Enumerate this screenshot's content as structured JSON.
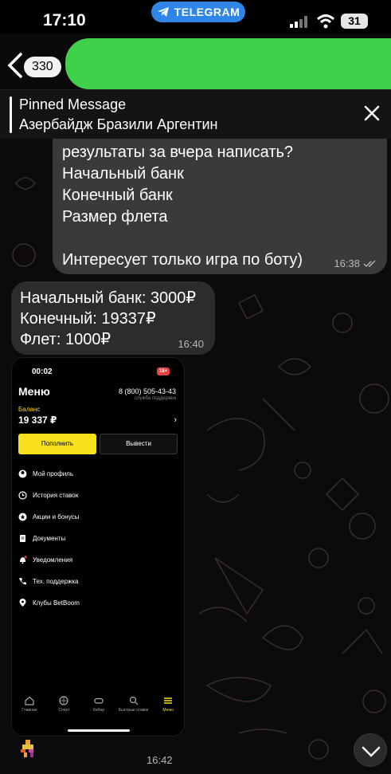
{
  "status_bar": {
    "time": "17:10",
    "app_pill": "TELEGRAM",
    "battery": "31"
  },
  "header": {
    "unread_count": "330"
  },
  "pinned": {
    "title": "Pinned Message",
    "text": "Азербайдж Бразили Аргентин"
  },
  "messages": {
    "outgoing": {
      "lines": [
        "результаты за вчера написать?",
        "Начальный банк",
        "Конечный банк",
        "Размер флета",
        "",
        "Интересует только игра по боту)"
      ],
      "time": "16:38"
    },
    "incoming": {
      "lines": [
        "Начальный банк: 3000₽",
        "Конечный: 19337₽",
        "Флет: 1000₽"
      ],
      "time": "16:40"
    },
    "last_time": "16:42"
  },
  "embedded": {
    "time": "00:02",
    "age": "18+",
    "title": "Меню",
    "phone": "8 (800) 505-43-43",
    "phone_sub": "служба поддержки",
    "balance_label": "Баланс",
    "balance": "19 337 ₽",
    "deposit": "Пополнить",
    "withdraw": "Вывести",
    "menu_items": [
      "Мой профиль",
      "История ставок",
      "Акции и бонусы",
      "Документы",
      "Уведомления",
      "Тех. поддержка",
      "Клубы BetBoom"
    ],
    "tabs": [
      "Главная",
      "Спорт",
      "Кибер",
      "Быстрые ставки",
      "Меню"
    ]
  },
  "colors": {
    "accent_yellow": "#f7e11b",
    "telegram_blue": "#2f86e6",
    "redaction_green": "#3fd14b"
  }
}
